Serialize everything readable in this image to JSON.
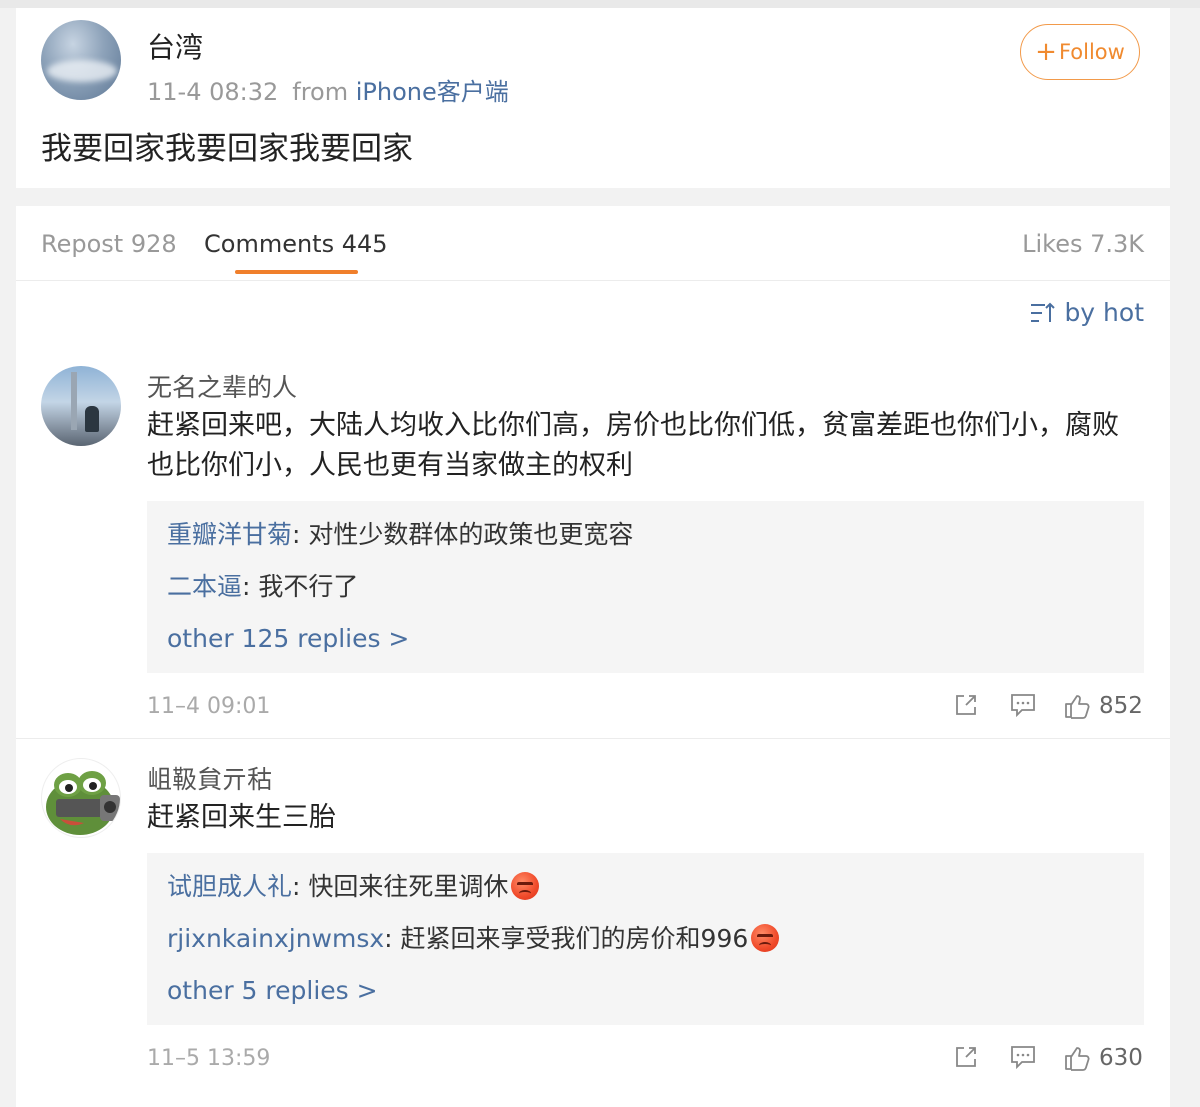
{
  "post": {
    "author": "台湾",
    "time": "11-4 08:32",
    "from_label": "from",
    "source": "iPhone客户端",
    "follow_label": "Follow",
    "text": "我要回家我要回家我要回家"
  },
  "tabs": {
    "repost": "Repost 928",
    "comments": "Comments 445",
    "likes": "Likes 7.3K"
  },
  "sort": {
    "label": "by hot"
  },
  "comments": [
    {
      "author": "无名之辈的人",
      "text": "赶紧回来吧，大陆人均收入比你们高，房价也比你们低，贫富差距也你们小，腐败也比你们小，人民也更有当家做主的权利",
      "replies": [
        {
          "name": "重瓣洋甘菊",
          "text": ": 对性少数群体的政策也更宽容"
        },
        {
          "name": "二本逼",
          "text": ": 我不行了"
        }
      ],
      "more": "other 125 replies >",
      "time": "11–4 09:01",
      "likes": "852"
    },
    {
      "author": "岨靸貟亓秙",
      "text": "赶紧回来生三胎",
      "replies": [
        {
          "name": "试胆成人礼",
          "text": ": 快回来往死里调休"
        },
        {
          "name": "rjixnkainxjnwmsx",
          "text": ": 赶紧回来享受我们的房价和996"
        }
      ],
      "more": "other 5 replies >",
      "time": "11–5 13:59",
      "likes": "630"
    }
  ],
  "colors": {
    "accent": "#f07f2b",
    "link": "#4a6fa0",
    "background": "#f2f2f2"
  },
  "icons": [
    "share-icon",
    "comment-icon",
    "thumbs-up-icon",
    "sort-icon",
    "angry-emoji-icon"
  ]
}
